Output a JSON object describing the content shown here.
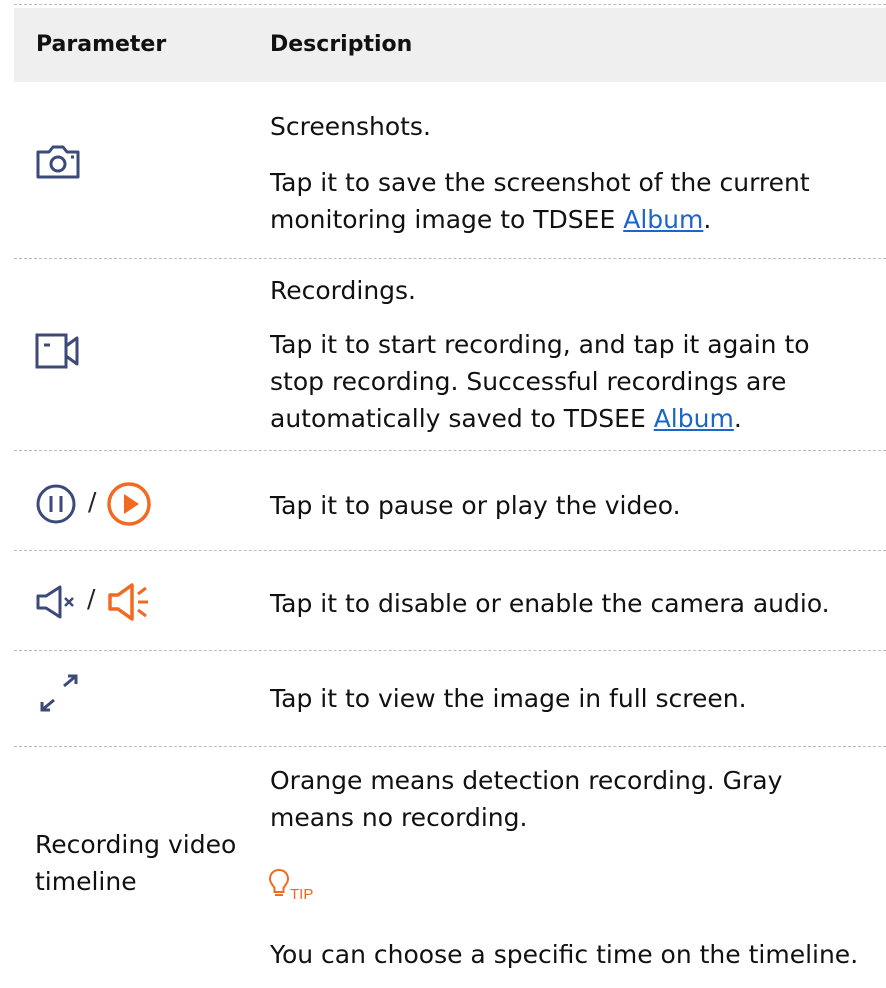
{
  "header": {
    "parameter": "Parameter",
    "description": "Description"
  },
  "rows": [
    {
      "icon": "camera-icon",
      "title": "Screenshots.",
      "desc_prefix": "Tap it to save the screenshot of the current monitoring image to TDSEE ",
      "link": "Album",
      "suffix": "."
    },
    {
      "icon": "video-camera-icon",
      "title": "Recordings.",
      "desc_prefix": "Tap it to start recording, and tap it again to stop recording. Successful recordings are automatically saved to TDSEE ",
      "link": "Album",
      "suffix": "."
    },
    {
      "icons": [
        "pause-icon",
        "play-icon"
      ],
      "separator": "/",
      "text": "Tap it to pause or play the video."
    },
    {
      "icons": [
        "speaker-muted-icon",
        "speaker-on-icon"
      ],
      "separator": "/",
      "text": "Tap it to disable or enable the camera audio."
    },
    {
      "icon": "fullscreen-icon",
      "text": "Tap it to view the image in full screen."
    },
    {
      "param": "Recording video timeline",
      "line1": "Orange means detection recording. Gray means no recording.",
      "tip_label": "TIP",
      "tip_text": "You can choose a specific time on the timeline."
    }
  ],
  "colors": {
    "icon_dark": "#3b4a78",
    "accent_orange": "#f26a21",
    "link_blue": "#1b66c9",
    "header_bg": "#efefef"
  }
}
